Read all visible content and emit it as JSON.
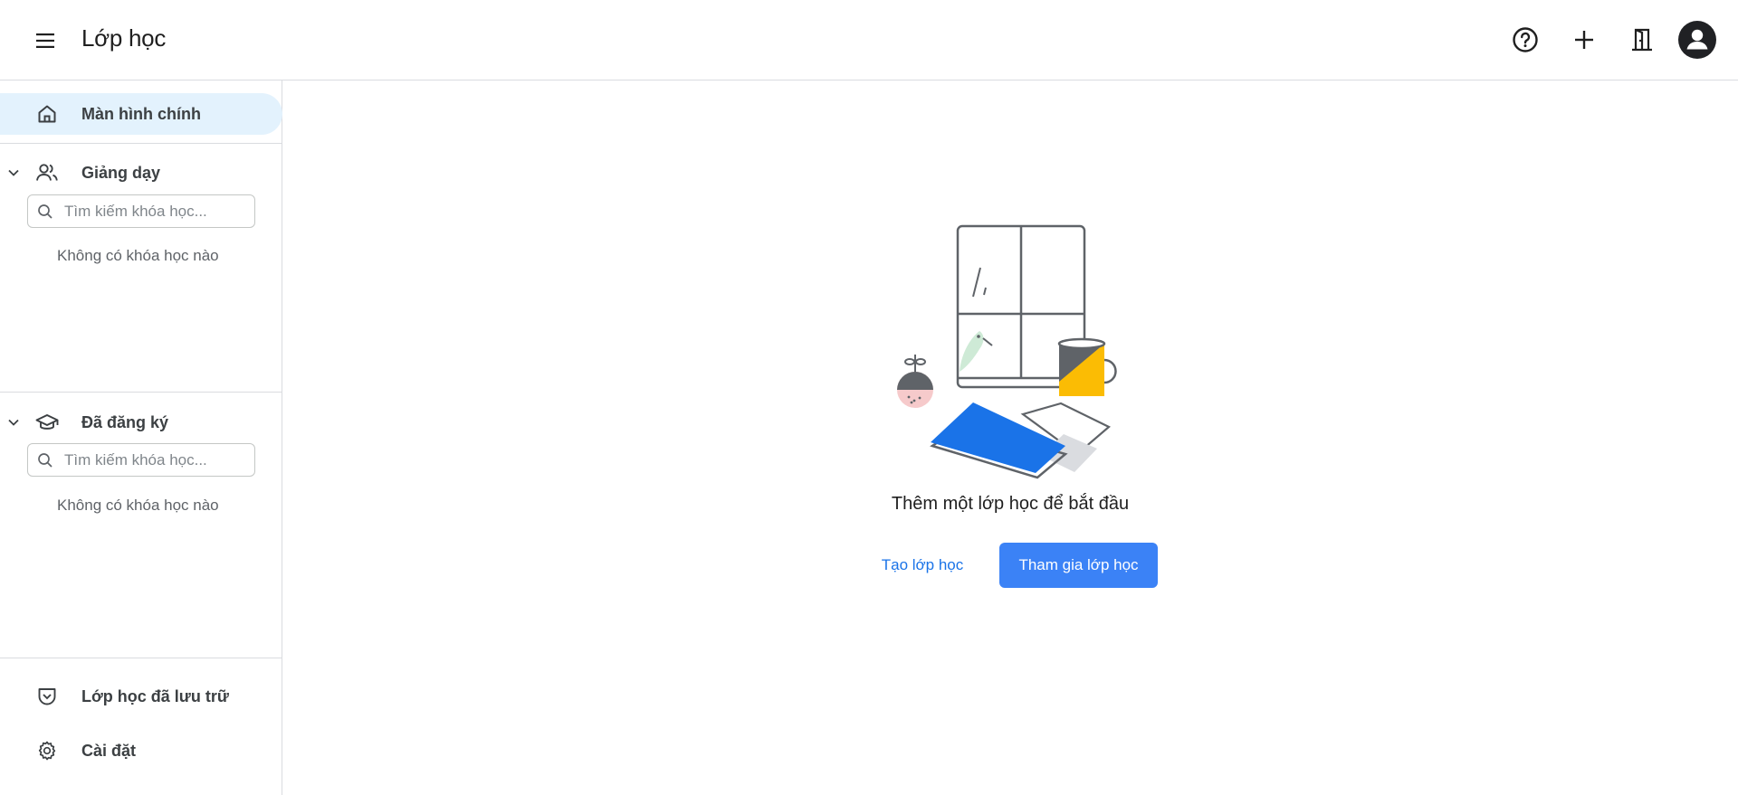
{
  "header": {
    "title": "Lớp học",
    "icons": [
      "menu-icon",
      "help-icon",
      "plus-icon",
      "door-icon",
      "account-icon"
    ]
  },
  "sidebar": {
    "home_label": "Màn hình chính",
    "teaching": {
      "label": "Giảng dạy",
      "search_placeholder": "Tìm kiếm khóa học...",
      "empty": "Không có khóa học nào"
    },
    "enrolled": {
      "label": "Đã đăng ký",
      "search_placeholder": "Tìm kiếm khóa học...",
      "empty": "Không có khóa học nào"
    },
    "archived_label": "Lớp học đã lưu trữ",
    "settings_label": "Cài đặt"
  },
  "main": {
    "message": "Thêm một lớp học để bắt đầu",
    "create_label": "Tạo lớp học",
    "join_label": "Tham gia lớp học"
  },
  "colors": {
    "accent": "#1a73e8",
    "button": "#3b82f6",
    "home_active_bg": "#e3f2fd",
    "book_blue": "#1a73e8",
    "mug_yellow": "#fbbc04"
  }
}
